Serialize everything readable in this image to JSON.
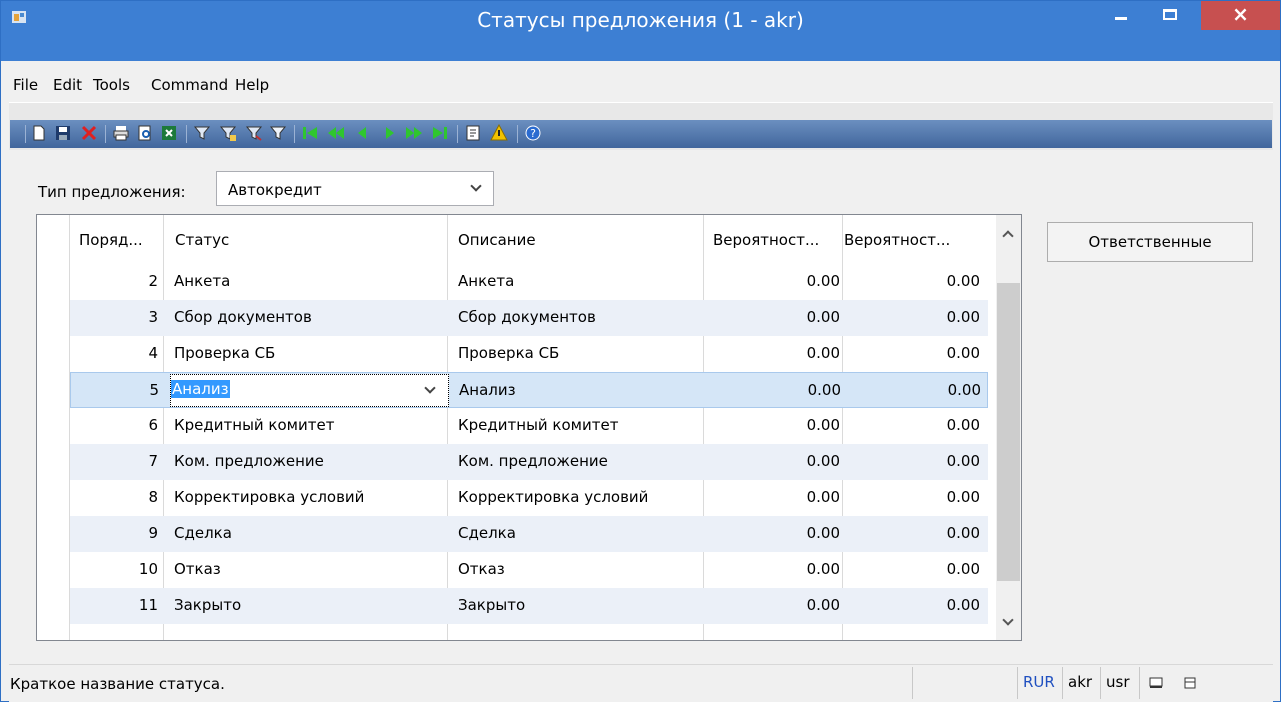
{
  "window": {
    "title": "Статусы предложения (1 - akr)",
    "close_glyph": "×"
  },
  "menu": [
    "File",
    "Edit",
    "Tools",
    "Command",
    "Help"
  ],
  "toolbar": {
    "icons": [
      "new-icon",
      "save-icon",
      "delete-icon",
      "print-icon",
      "print-preview-icon",
      "excel-export-icon",
      "filter-icon",
      "filter-by-selection-icon",
      "advanced-filter-icon",
      "clear-filter-icon",
      "first-record-icon",
      "prev-page-icon",
      "prev-record-icon",
      "next-record-icon",
      "next-page-icon",
      "last-record-icon",
      "document-icon",
      "alert-icon",
      "help-icon"
    ]
  },
  "filter": {
    "label": "Тип предложения:",
    "value": "Автокредит"
  },
  "grid": {
    "headers": [
      "Поряд...",
      "Статус",
      "Описание",
      "Вероятност...",
      "Вероятност..."
    ],
    "rows": [
      {
        "order": "2",
        "status": "Анкета",
        "description": "Анкета",
        "prob1": "0.00",
        "prob2": "0.00"
      },
      {
        "order": "3",
        "status": "Сбор документов",
        "description": "Сбор документов",
        "prob1": "0.00",
        "prob2": "0.00"
      },
      {
        "order": "4",
        "status": "Проверка СБ",
        "description": "Проверка СБ",
        "prob1": "0.00",
        "prob2": "0.00"
      },
      {
        "order": "5",
        "status": "Анализ",
        "description": "Анализ",
        "prob1": "0.00",
        "prob2": "0.00"
      },
      {
        "order": "6",
        "status": "Кредитный комитет",
        "description": "Кредитный комитет",
        "prob1": "0.00",
        "prob2": "0.00"
      },
      {
        "order": "7",
        "status": "Ком. предложение",
        "description": "Ком. предложение",
        "prob1": "0.00",
        "prob2": "0.00"
      },
      {
        "order": "8",
        "status": "Корректировка условий",
        "description": "Корректировка условий",
        "prob1": "0.00",
        "prob2": "0.00"
      },
      {
        "order": "9",
        "status": "Сделка",
        "description": "Сделка",
        "prob1": "0.00",
        "prob2": "0.00"
      },
      {
        "order": "10",
        "status": "Отказ",
        "description": "Отказ",
        "prob1": "0.00",
        "prob2": "0.00"
      },
      {
        "order": "11",
        "status": "Закрыто",
        "description": "Закрыто",
        "prob1": "0.00",
        "prob2": "0.00"
      }
    ],
    "selected_index": 3
  },
  "side_button": {
    "label": "Ответственные"
  },
  "statusbar": {
    "message": "Краткое название статуса.",
    "currency": "RUR",
    "company": "akr",
    "layer": "usr"
  },
  "colors": {
    "titlebar": "#3d7fd3",
    "close_button": "#c75050",
    "selection": "#3399ff",
    "row_alt": "#ebf0f8"
  }
}
